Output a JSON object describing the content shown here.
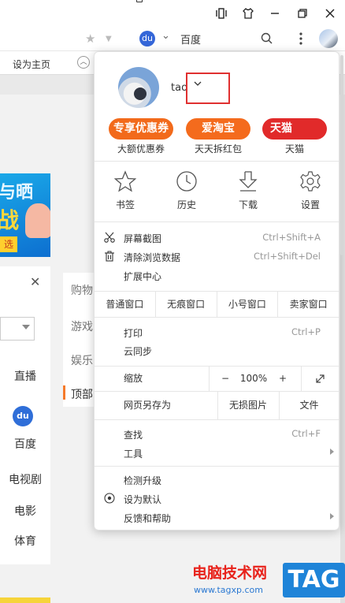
{
  "chrome": {
    "search_engine_label": "百度"
  },
  "bookmarks": {
    "set_home_label": "设为主页"
  },
  "background_page": {
    "banner_text_1": "与晒",
    "banner_text_2": "战",
    "banner_button": "选",
    "left_items": [
      "直播",
      "百度",
      "电视剧",
      "电影",
      "体育"
    ],
    "mid_items": [
      "购物",
      "游戏",
      "娱乐",
      "顶部"
    ]
  },
  "watermark": {
    "title": "电脑技术网",
    "url": "www.tagxp.com",
    "tag": "TAG"
  },
  "menu": {
    "profile": {
      "name": "tao"
    },
    "promos": [
      {
        "badge": "专享优惠券",
        "label": "大额优惠券",
        "color": "#f26a1b"
      },
      {
        "badge": "爱淘宝",
        "label": "天天拆红包",
        "color": "#f46b1d"
      },
      {
        "badge": "天猫",
        "label": "天猫",
        "color": "#e12a2a"
      }
    ],
    "tools": [
      {
        "label": "书签",
        "icon": "star-icon"
      },
      {
        "label": "历史",
        "icon": "clock-icon"
      },
      {
        "label": "下载",
        "icon": "download-icon"
      },
      {
        "label": "设置",
        "icon": "gear-icon"
      }
    ],
    "items_group1": [
      {
        "label": "屏幕截图",
        "shortcut": "Ctrl+Shift+A"
      },
      {
        "label": "清除浏览数据",
        "shortcut": "Ctrl+Shift+Del"
      },
      {
        "label": "扩展中心",
        "shortcut": ""
      }
    ],
    "window_buttons": [
      "普通窗口",
      "无痕窗口",
      "小号窗口",
      "卖家窗口"
    ],
    "items_group2": [
      {
        "label": "打印",
        "shortcut": "Ctrl+P"
      },
      {
        "label": "云同步",
        "shortcut": ""
      }
    ],
    "zoom": {
      "label": "缩放",
      "minus": "−",
      "value": "100%",
      "plus": "+"
    },
    "save": {
      "label": "网页另存为",
      "lossless_image": "无损图片",
      "file": "文件"
    },
    "items_group3": [
      {
        "label": "查找",
        "shortcut": "Ctrl+F"
      },
      {
        "label": "工具",
        "shortcut": ""
      }
    ],
    "items_group4": [
      {
        "label": "检测升级"
      },
      {
        "label": "设为默认"
      },
      {
        "label": "反馈和帮助"
      }
    ]
  }
}
